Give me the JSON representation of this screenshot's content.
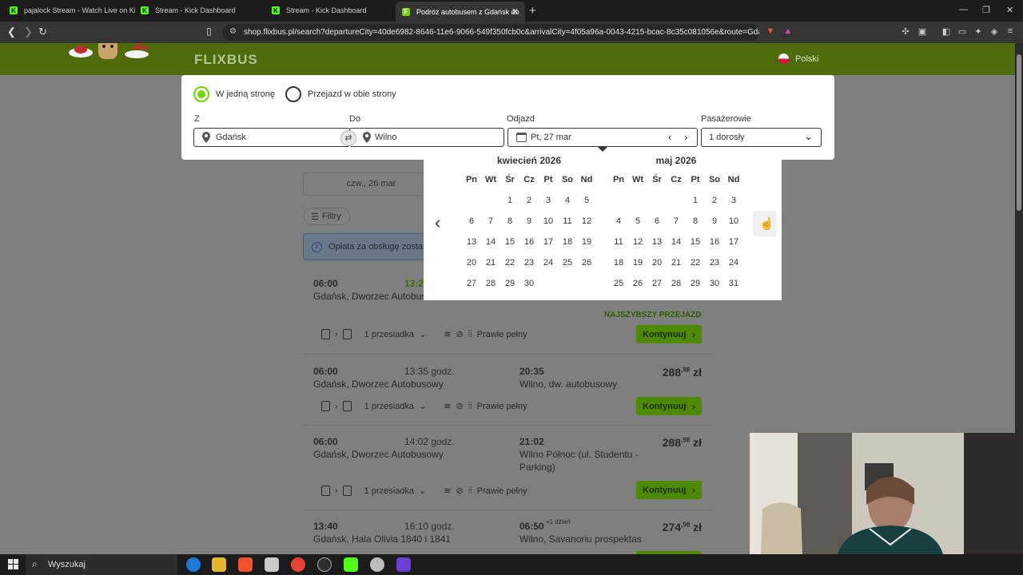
{
  "browser": {
    "tabs": [
      {
        "title": "pajalock Stream - Watch Live on Kick",
        "icon": "kick-icon",
        "active": false
      },
      {
        "title": "Stream - Kick Dashboard",
        "icon": "kick-icon",
        "active": false
      },
      {
        "title": "Stream - Kick Dashboard",
        "icon": "kick-icon",
        "active": false
      },
      {
        "title": "Podróż autobusem z Gdańsk do",
        "icon": "flixbus-icon",
        "active": true
      }
    ],
    "url": "shop.flixbus.pl/search?departureCity=40de6982-8646-11e6-9066-549f350fcb0c&arrivalCity=4f05a96a-0043-4215-bcac-8c35c081056e&route=Gdańs..."
  },
  "site": {
    "logo": "FLIXBUS",
    "language": "Polski"
  },
  "search": {
    "one_way": "W jedną stronę",
    "round_trip": "Przejazd w obie strony",
    "from_label": "Z",
    "from_value": "Gdańsk",
    "to_label": "Do",
    "to_value": "Wilno",
    "date_label": "Odjazd",
    "date_value": "Pt, 27 mar",
    "passengers_label": "Pasażerowie",
    "passengers_value": "1 dorosły"
  },
  "calendar": {
    "weekdays": [
      "Pn",
      "Wt",
      "Śr",
      "Cz",
      "Pt",
      "So",
      "Nd"
    ],
    "months": [
      {
        "title": "kwiecień 2026",
        "weeks": [
          [
            "",
            "",
            "1",
            "2",
            "3",
            "4",
            "5"
          ],
          [
            "6",
            "7",
            "8",
            "9",
            "10",
            "11",
            "12"
          ],
          [
            "13",
            "14",
            "15",
            "16",
            "17",
            "18",
            "19"
          ],
          [
            "20",
            "21",
            "22",
            "23",
            "24",
            "25",
            "26"
          ],
          [
            "27",
            "28",
            "29",
            "30",
            "",
            "",
            ""
          ]
        ]
      },
      {
        "title": "maj 2026",
        "weeks": [
          [
            "",
            "",
            "",
            "",
            "1",
            "2",
            "3"
          ],
          [
            "4",
            "5",
            "6",
            "7",
            "8",
            "9",
            "10"
          ],
          [
            "11",
            "12",
            "13",
            "14",
            "15",
            "16",
            "17"
          ],
          [
            "18",
            "19",
            "20",
            "21",
            "22",
            "23",
            "24"
          ],
          [
            "25",
            "26",
            "27",
            "28",
            "29",
            "30",
            "31"
          ]
        ]
      }
    ]
  },
  "results": {
    "day_tab": "czw., 26 mar",
    "filters": "Filtry",
    "info": "Opłata za obsługę zostan",
    "fastest": "NAJSZYBSZY PRZEJAZD",
    "trips": [
      {
        "dep": "06:00",
        "arr_time_partial": "13:2",
        "from": "Gdańsk, Dworzec Autobus",
        "duration": "",
        "arr": "",
        "to": "",
        "price": "",
        "cents": "",
        "transfers": "1 przesiadka",
        "occupancy": "Prawie pełny",
        "cta": "Kontynuuj"
      },
      {
        "dep": "06:00",
        "arr_time_partial": "",
        "from": "Gdańsk, Dworzec Autobusowy",
        "duration": "13:35 godz.",
        "arr": "20:35",
        "to": "Wilno, dw. autobusowy",
        "price": "288",
        "cents": ",98",
        "transfers": "1 przesiadka",
        "occupancy": "Prawie pełny",
        "cta": "Kontynuuj"
      },
      {
        "dep": "06:00",
        "arr_time_partial": "",
        "from": "Gdańsk, Dworzec Autobusowy",
        "duration": "14:02 godz.",
        "arr": "21:02",
        "to": "Wilno Północ (ul. Studentu -",
        "to2": "Parking)",
        "price": "288",
        "cents": ",98",
        "transfers": "1 przesiadka",
        "occupancy": "Prawie pełny",
        "cta": "Kontynuuj"
      },
      {
        "dep": "13:40",
        "arr_time_partial": "",
        "from": "Gdańsk, Hala Olivia 1840 i 1841",
        "duration": "16:10 godz.",
        "arr": "06:50",
        "extra_day": "+1 dzień",
        "to": "Wilno, Savanoriu prospektas",
        "price": "274",
        "cents": ",98"
      }
    ],
    "currency": "zł"
  },
  "taskbar": {
    "search_placeholder": "Wyszukaj"
  },
  "colors": {
    "brand_green": "#73d700",
    "header_dim": "#4f6b0d"
  }
}
